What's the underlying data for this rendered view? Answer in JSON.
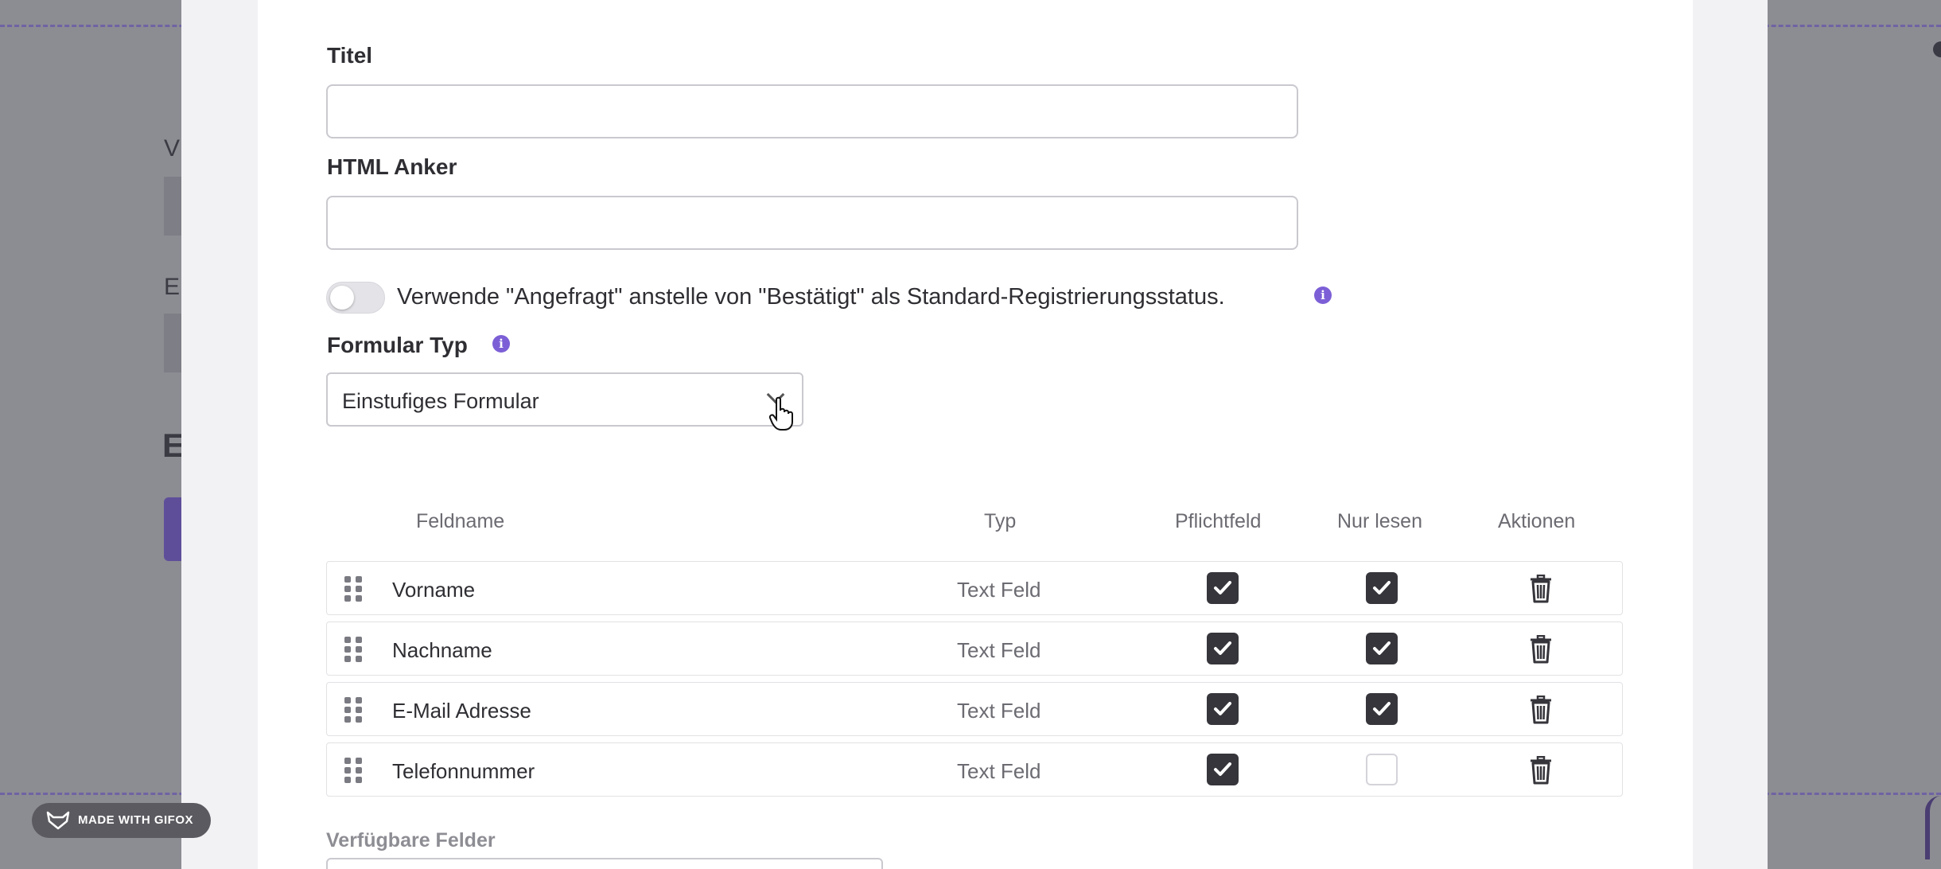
{
  "form": {
    "title_label": "Titel",
    "title_value": "",
    "anchor_label": "HTML Anker",
    "anchor_value": "",
    "toggle_label": "Verwende \"Angefragt\" anstelle von \"Bestätigt\" als Standard-Registrierungsstatus.",
    "toggle_on": false,
    "form_type_label": "Formular Typ",
    "form_type_value": "Einstufiges Formular"
  },
  "table": {
    "headers": {
      "fieldname": "Feldname",
      "type": "Typ",
      "required": "Pflichtfeld",
      "readonly": "Nur lesen",
      "actions": "Aktionen"
    },
    "rows": [
      {
        "name": "Vorname",
        "type": "Text Feld",
        "required": true,
        "readonly": true
      },
      {
        "name": "Nachname",
        "type": "Text Feld",
        "required": true,
        "readonly": true
      },
      {
        "name": "E-Mail Adresse",
        "type": "Text Feld",
        "required": true,
        "readonly": true
      },
      {
        "name": "Telefonnummer",
        "type": "Text Feld",
        "required": true,
        "readonly": false
      }
    ]
  },
  "available_fields_label": "Verfügbare Felder",
  "background": {
    "text_v": "V",
    "text_e": "E",
    "heading_e": "E"
  },
  "watermark": "MADE WITH GIFOX",
  "colors": {
    "accent": "#7c5fd6",
    "checkbox": "#35353b",
    "overlay": "#8c8c93"
  }
}
